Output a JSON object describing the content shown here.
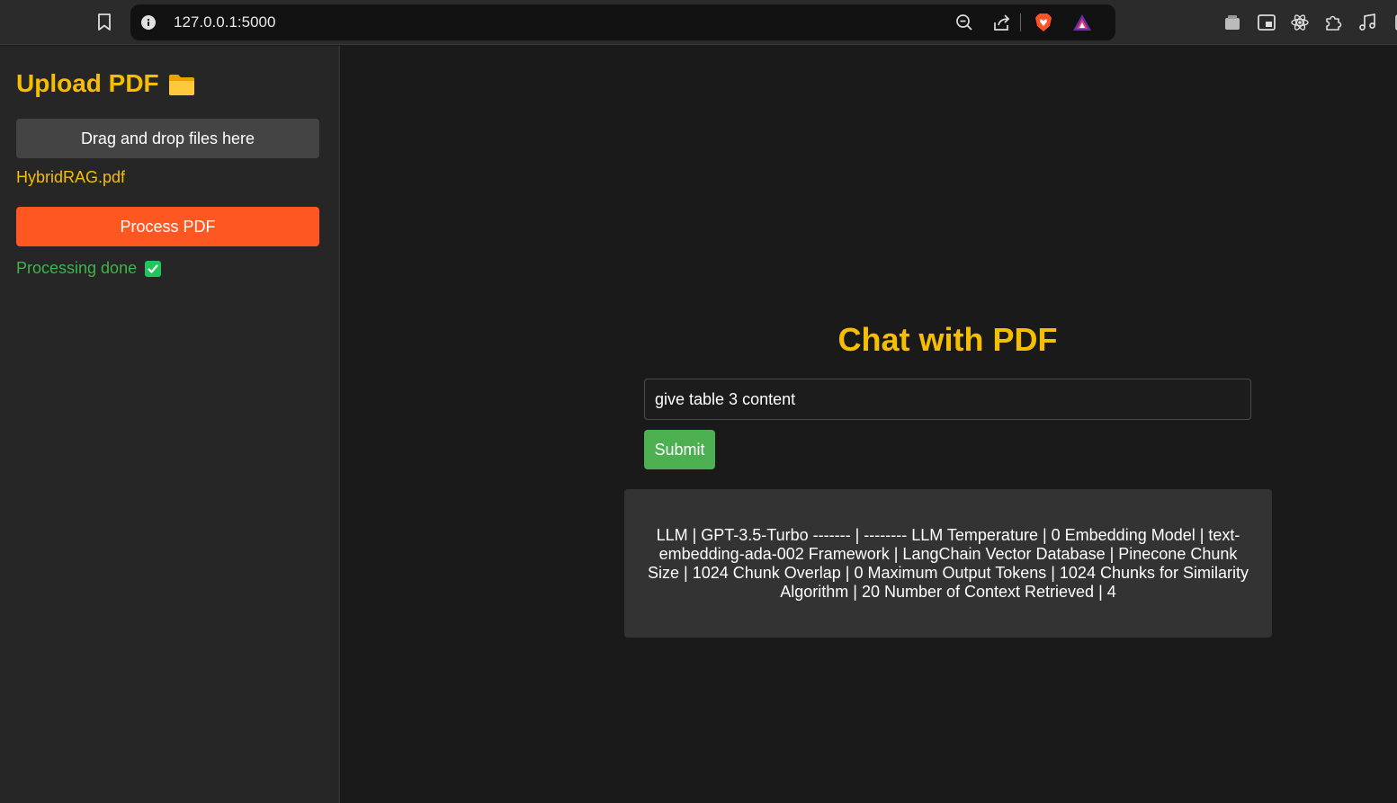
{
  "browser": {
    "url": "127.0.0.1:5000",
    "icons": {
      "bookmark": "bookmark-icon",
      "site_info": "info-icon",
      "zoom": "zoom-out-icon",
      "share": "share-icon",
      "brave": "brave-shields-icon",
      "rewards": "brave-rewards-icon",
      "extensions": [
        "wallet-icon",
        "picture-in-picture-icon",
        "react-devtools-icon",
        "extensions-puzzle-icon",
        "media-music-icon"
      ]
    }
  },
  "sidebar": {
    "title": "Upload PDF",
    "title_icon": "folder-icon",
    "dropzone_label": "Drag and drop files here",
    "uploaded_file": "HybridRAG.pdf",
    "process_button": "Process PDF",
    "status_text": "Processing done",
    "status_icon": "check-icon"
  },
  "main": {
    "title": "Chat with PDF",
    "query_value": "give table 3 content",
    "submit_label": "Submit",
    "answer": "LLM | GPT-3.5-Turbo ------- | -------- LLM Temperature | 0 Embedding Model | text-embedding-ada-002 Framework | LangChain Vector Database | Pinecone Chunk Size | 1024 Chunk Overlap | 0 Maximum Output Tokens | 1024 Chunks for Similarity Algorithm | 20 Number of Context Retrieved | 4"
  },
  "colors": {
    "accent_yellow": "#f6be00",
    "process_orange": "#ff5722",
    "submit_green": "#4caf50",
    "status_green": "#3cb648",
    "sidebar_bg": "#262626",
    "main_bg": "#1a1a1a"
  }
}
